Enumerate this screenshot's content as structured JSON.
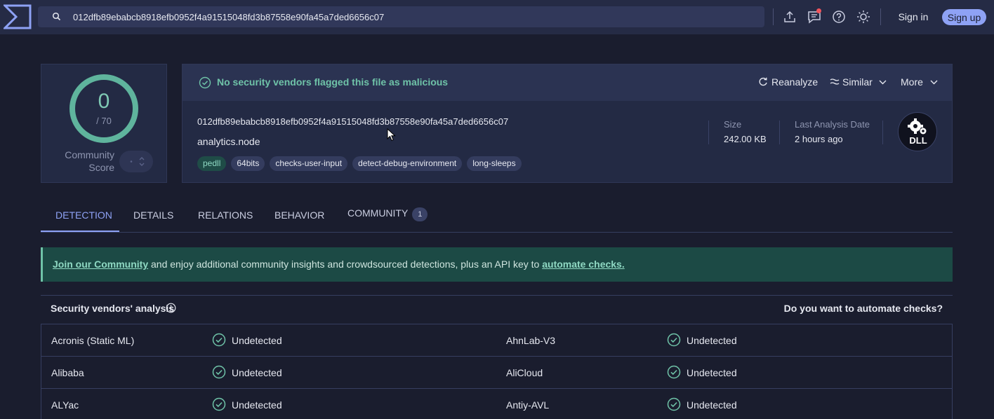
{
  "search": {
    "value": "012dfb89ebabcb8918efb0952f4a91515048fd3b87558e90fa45a7ded6656c07"
  },
  "header": {
    "sign_in": "Sign in",
    "sign_up": "Sign up"
  },
  "icons": [
    "logo-icon",
    "search-icon",
    "upload-icon",
    "chat-icon",
    "help-icon",
    "theme-icon"
  ],
  "score": {
    "detected": "0",
    "total": "/ 70",
    "community_label": "Community Score"
  },
  "status": {
    "text": "No security vendors flagged this file as malicious"
  },
  "actions": {
    "reanalyze": "Reanalyze",
    "similar": "Similar",
    "more": "More"
  },
  "file": {
    "hash": "012dfb89ebabcb8918efb0952f4a91515048fd3b87558e90fa45a7ded6656c07",
    "name": "analytics.node",
    "tags": [
      "pedll",
      "64bits",
      "checks-user-input",
      "detect-debug-environment",
      "long-sleeps"
    ],
    "size_label": "Size",
    "size_value": "242.00 KB",
    "date_label": "Last Analysis Date",
    "date_value": "2 hours ago",
    "type_badge": "DLL"
  },
  "tabs": [
    {
      "label": "DETECTION"
    },
    {
      "label": "DETAILS"
    },
    {
      "label": "RELATIONS"
    },
    {
      "label": "BEHAVIOR"
    },
    {
      "label": "COMMUNITY",
      "count": "1"
    }
  ],
  "banner": {
    "link1": "Join our Community",
    "middle": " and enjoy additional community insights and crowdsourced detections, plus an API key to ",
    "link2": "automate checks."
  },
  "vendors": {
    "title": "Security vendors' analysis",
    "automate": "Do you want to automate checks?",
    "rows": [
      {
        "left_name": "Acronis (Static ML)",
        "left_status": "Undetected",
        "right_name": "AhnLab-V3",
        "right_status": "Undetected"
      },
      {
        "left_name": "Alibaba",
        "left_status": "Undetected",
        "right_name": "AliCloud",
        "right_status": "Undetected"
      },
      {
        "left_name": "ALYac",
        "left_status": "Undetected",
        "right_name": "Antiy-AVL",
        "right_status": "Undetected"
      }
    ]
  },
  "colors": {
    "accent": "#8ea2f5",
    "clean": "#6fc3a8",
    "background": "#1a1d2e",
    "topbar": "#252b45"
  }
}
